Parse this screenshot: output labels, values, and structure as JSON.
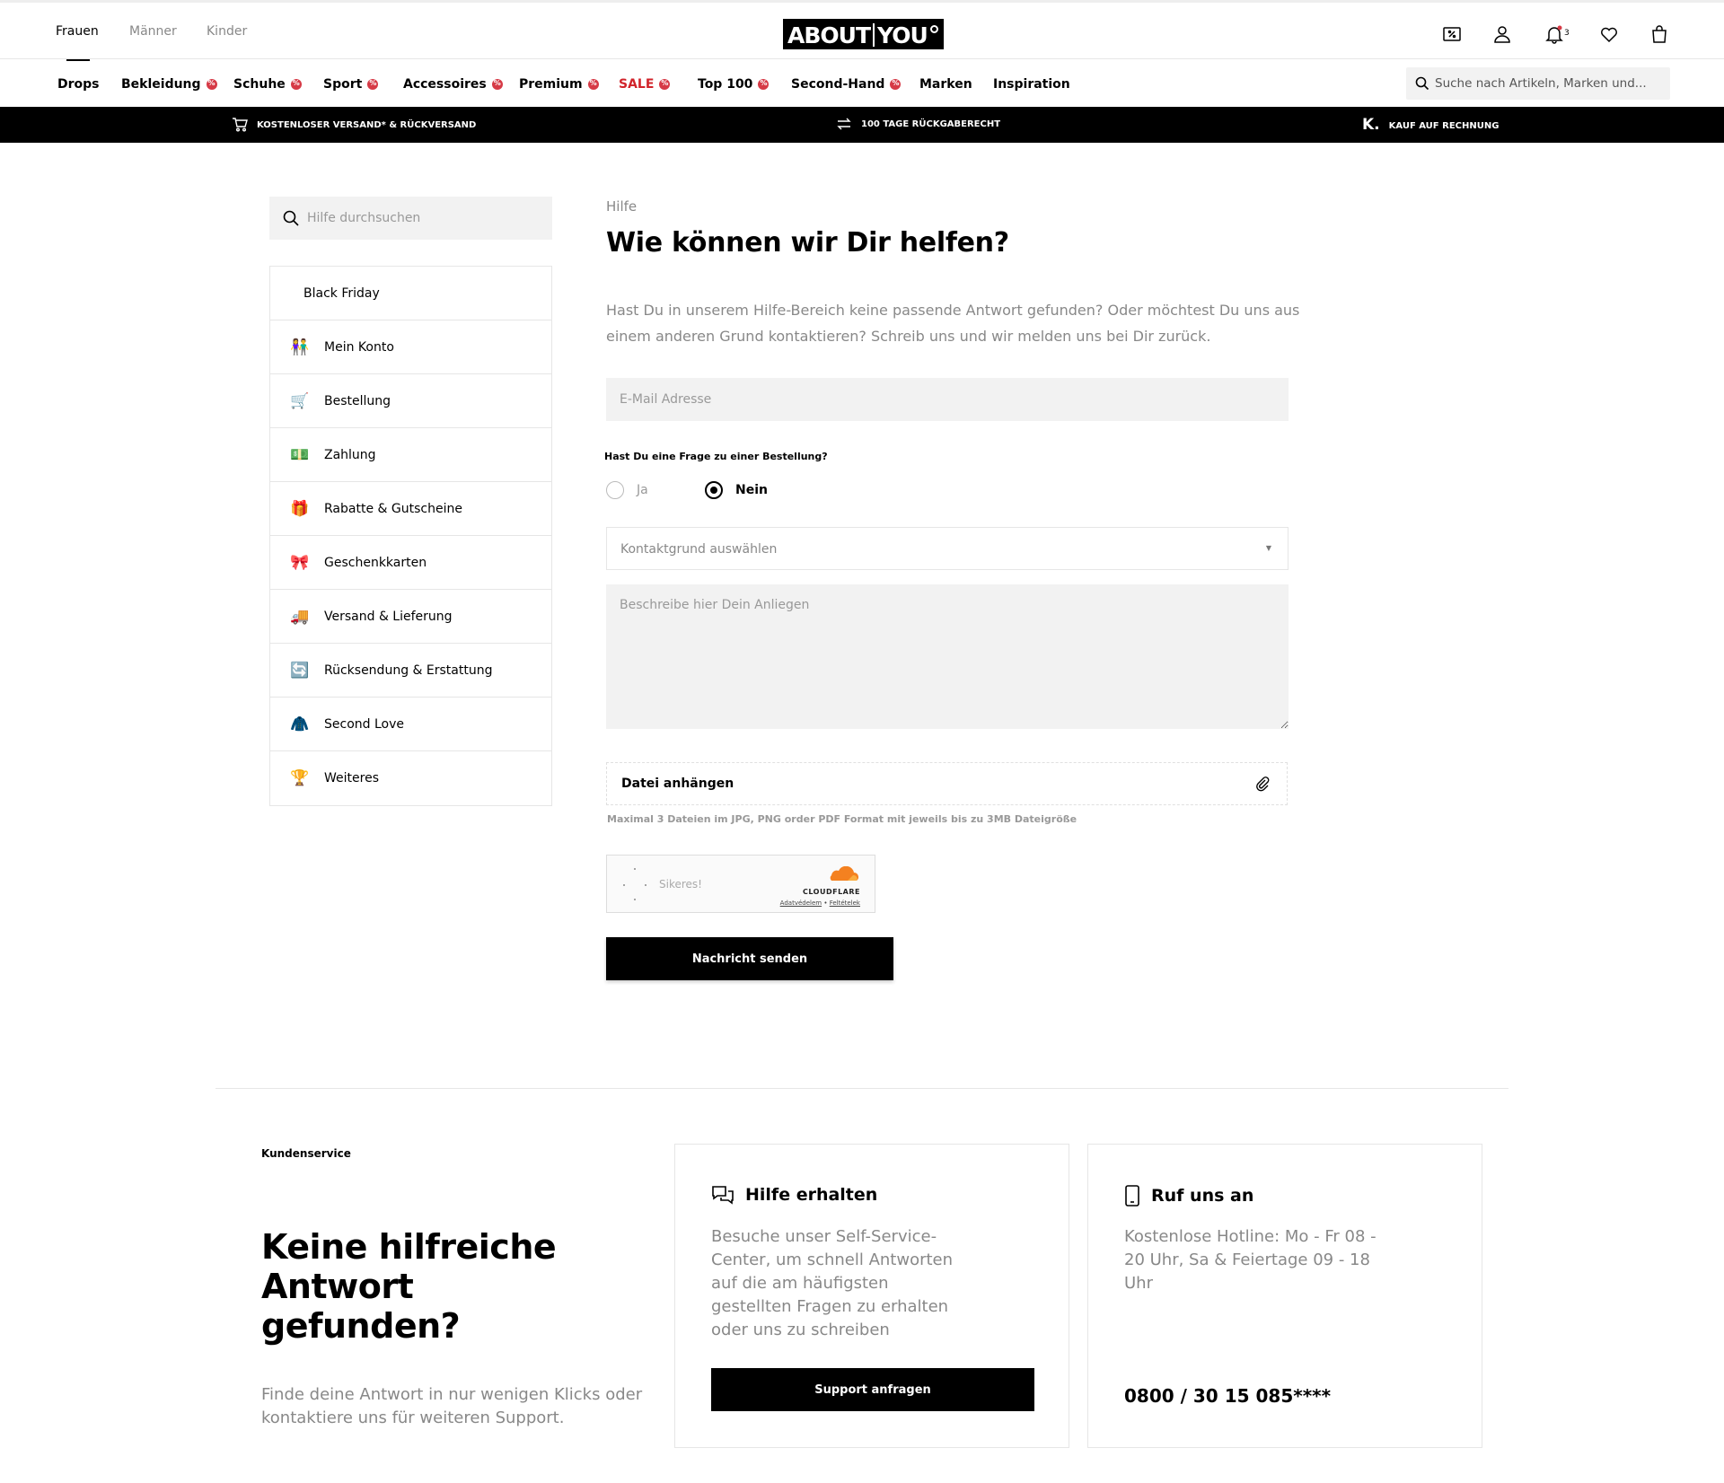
{
  "header": {
    "genders": [
      "Frauen",
      "Männer",
      "Kinder"
    ],
    "logo_left": "ABOUT",
    "logo_right": "YOU",
    "notification_count": "3"
  },
  "nav": {
    "items": [
      {
        "label": "Drops",
        "badge": false
      },
      {
        "label": "Bekleidung",
        "badge": true
      },
      {
        "label": "Schuhe",
        "badge": true
      },
      {
        "label": "Sport",
        "badge": true
      },
      {
        "label": "Accessoires",
        "badge": true
      },
      {
        "label": "Premium",
        "badge": true
      },
      {
        "label": "SALE",
        "badge": true
      },
      {
        "label": "Top 100",
        "badge": true
      },
      {
        "label": "Second-Hand",
        "badge": true
      },
      {
        "label": "Marken",
        "badge": false
      },
      {
        "label": "Inspiration",
        "badge": false
      }
    ],
    "search_placeholder": "Suche nach Artikeln, Marken und..."
  },
  "usp": {
    "shipping": "KOSTENLOSER VERSAND* & RÜCKVERSAND",
    "returns": "100 TAGE RÜCKGABERECHT",
    "invoice_logo": "K.",
    "invoice": "KAUF AUF RECHNUNG"
  },
  "sidebar": {
    "search_placeholder": "Hilfe durchsuchen",
    "items": [
      {
        "label": "Black Friday",
        "icon": ""
      },
      {
        "label": "Mein Konto",
        "icon": "👫"
      },
      {
        "label": "Bestellung",
        "icon": "🛒"
      },
      {
        "label": "Zahlung",
        "icon": "💵"
      },
      {
        "label": "Rabatte & Gutscheine",
        "icon": "🎁"
      },
      {
        "label": "Geschenkkarten",
        "icon": "🎀"
      },
      {
        "label": "Versand & Lieferung",
        "icon": "🚚"
      },
      {
        "label": "Rücksendung & Erstattung",
        "icon": "🔄"
      },
      {
        "label": "Second Love",
        "icon": "🧥"
      },
      {
        "label": "Weiteres",
        "icon": "🏆"
      }
    ]
  },
  "main": {
    "breadcrumb": "Hilfe",
    "title": "Wie können wir Dir helfen?",
    "intro": "Hast Du in unserem Hilfe-Bereich keine passende Antwort gefunden? Oder möchtest Du uns aus einem anderen Grund kontaktieren? Schreib uns und wir melden uns bei Dir zurück.",
    "email_placeholder": "E-Mail Adresse",
    "order_question": "Hast Du eine Frage zu einer Bestellung?",
    "radio_yes": "Ja",
    "radio_no": "Nein",
    "radio_selected": "Nein",
    "reason_placeholder": "Kontaktgrund auswählen",
    "message_placeholder": "Beschreibe hier Dein Anliegen",
    "attach_label": "Datei anhängen",
    "attach_hint": "Maximal 3 Dateien im JPG, PNG order PDF Format mit jeweils bis zu 3MB Dateigröße",
    "captcha_status": "Sikeres!",
    "captcha_brand": "CLOUDFLARE",
    "captcha_privacy": "Adatvédelem",
    "captcha_terms": "Feltételek",
    "send_label": "Nachricht senden"
  },
  "service": {
    "label": "Kundenservice",
    "title": "Keine hilfreiche Antwort gefunden?",
    "text": "Finde deine Antwort in nur wenigen Klicks oder kontaktiere uns für weiteren Support.",
    "help_card": {
      "title": "Hilfe erhalten",
      "text": "Besuche unser Self-Service-Center, um schnell Antworten auf die am häufigsten gestellten Fragen zu erhalten oder uns zu schreiben",
      "button": "Support anfragen"
    },
    "call_card": {
      "title": "Ruf uns an",
      "text": "Kostenlose Hotline: Mo - Fr 08 - 20 Uhr, Sa & Feiertage 09 - 18 Uhr",
      "phone": "0800 / 30 15 085****"
    }
  },
  "colors": {
    "sale": "#d1232a",
    "badge": "#d63a46",
    "input_bg": "#f2f2f2",
    "muted_text": "#888888"
  }
}
